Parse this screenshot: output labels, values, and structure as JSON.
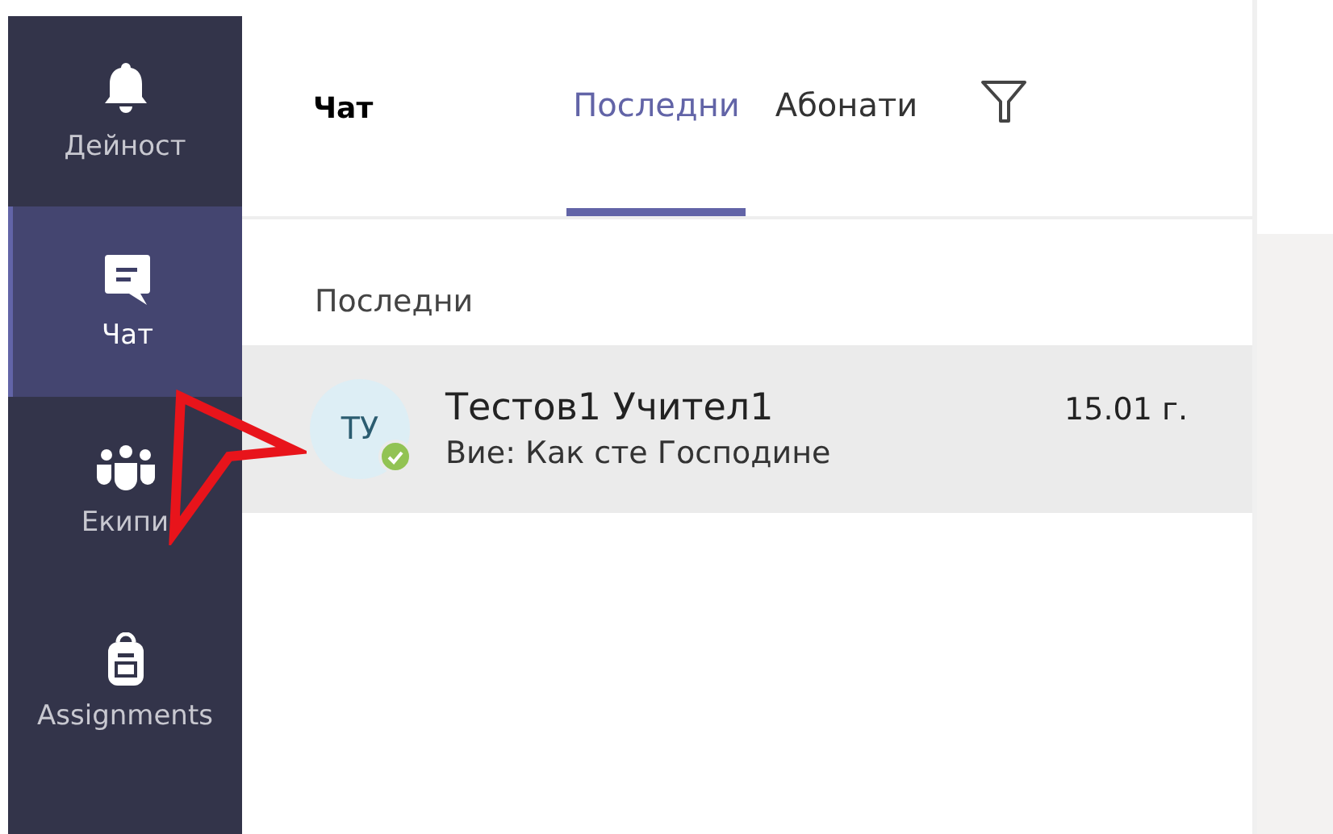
{
  "sidebar": {
    "items": [
      {
        "kind": "bell",
        "label": "Дейност",
        "selected": false
      },
      {
        "kind": "chat",
        "label": "Чат",
        "selected": true
      },
      {
        "kind": "teams",
        "label": "Екипи",
        "selected": false
      },
      {
        "kind": "backpack",
        "label": "Assignments",
        "selected": false
      }
    ]
  },
  "header": {
    "title": "Чат",
    "tabs": [
      {
        "label": "Последни",
        "selected": true
      },
      {
        "label": "Абонати",
        "selected": false
      }
    ]
  },
  "section_label": "Последни",
  "conversations": [
    {
      "initials": "ТУ",
      "name": "Тестов1 Учител1",
      "preview": "Вие: Как сте Господине",
      "time": "15.01 г.",
      "online": true,
      "selected": true
    }
  ]
}
